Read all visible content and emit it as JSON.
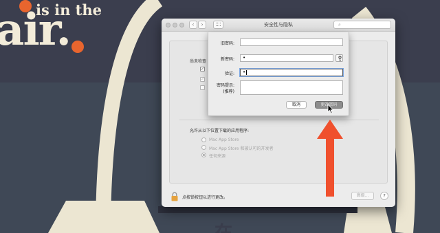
{
  "wallpaper": {
    "line1": "is in the",
    "big_text": "air.",
    "bottom_text": "在",
    "accent_color": "#e8652e"
  },
  "window": {
    "title": "安全性与隐私",
    "nav_back": "‹",
    "nav_forward": "›",
    "search_icon": "magnifier-icon"
  },
  "pane": {
    "section_label": "尚未检查",
    "allow_apps_label": "允许从以下位置下载的应用程序:",
    "radio_options": [
      {
        "label": "Mac App Store",
        "selected": false
      },
      {
        "label": "Mac App Store 和被认可的开发者",
        "selected": false
      },
      {
        "label": "任何来源",
        "selected": true
      }
    ]
  },
  "footer": {
    "lock_label": "点按锁按钮以进行更改。",
    "advanced_label": "高级...",
    "help_label": "?"
  },
  "sheet": {
    "old_password_label": "旧密码:",
    "old_password_value": "",
    "new_password_label": "新密码:",
    "new_password_value": "•",
    "verify_label": "验证:",
    "verify_value": "•",
    "hint_label": "密码提示:",
    "hint_sublabel": "(推荐)",
    "hint_value": "",
    "cancel_label": "取消",
    "change_label": "更改密码"
  },
  "colors": {
    "desktop_bg": "#3a3d4c",
    "arrow": "#f0502d"
  }
}
